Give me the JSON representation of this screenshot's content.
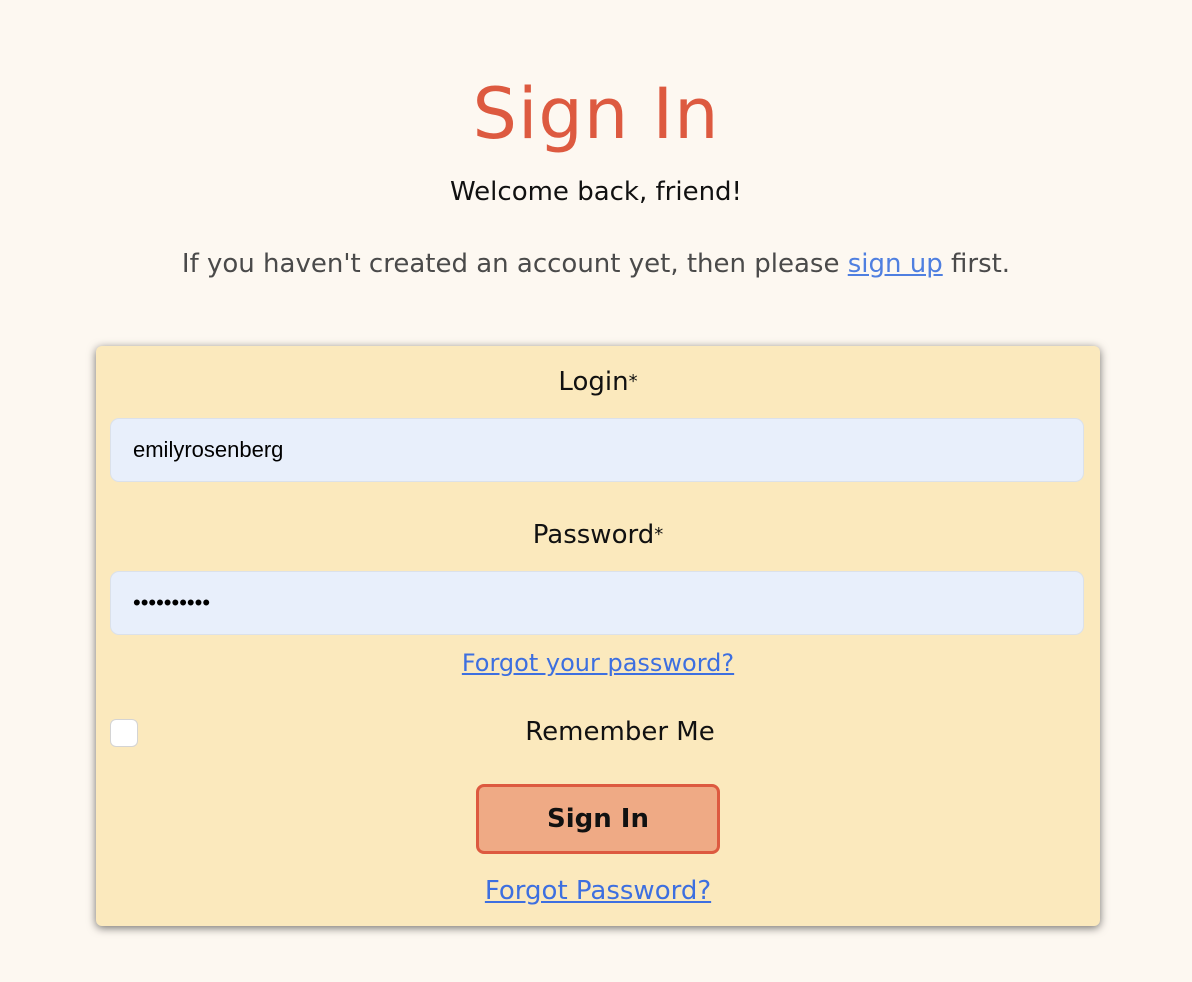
{
  "header": {
    "title": "Sign In",
    "welcome": "Welcome back, friend!",
    "signup_prefix": "If you haven't created an account yet, then please ",
    "signup_link": "sign up",
    "signup_suffix": " first."
  },
  "form": {
    "login_label": "Login",
    "password_label": "Password",
    "required_marker": "*",
    "login_value": "emilyrosenberg",
    "password_value": "••••••••••",
    "forgot_password_link": "Forgot your password?",
    "remember_label": "Remember Me",
    "remember_checked": false,
    "submit_label": "Sign In",
    "forgot_password_bottom": "Forgot Password?"
  },
  "colors": {
    "page_background": "#fdf8f1",
    "card_background": "#fbe9bd",
    "accent": "#dd5a40",
    "button_fill": "#efaa85",
    "input_background": "#e8effb",
    "link": "#3d6fe0"
  }
}
